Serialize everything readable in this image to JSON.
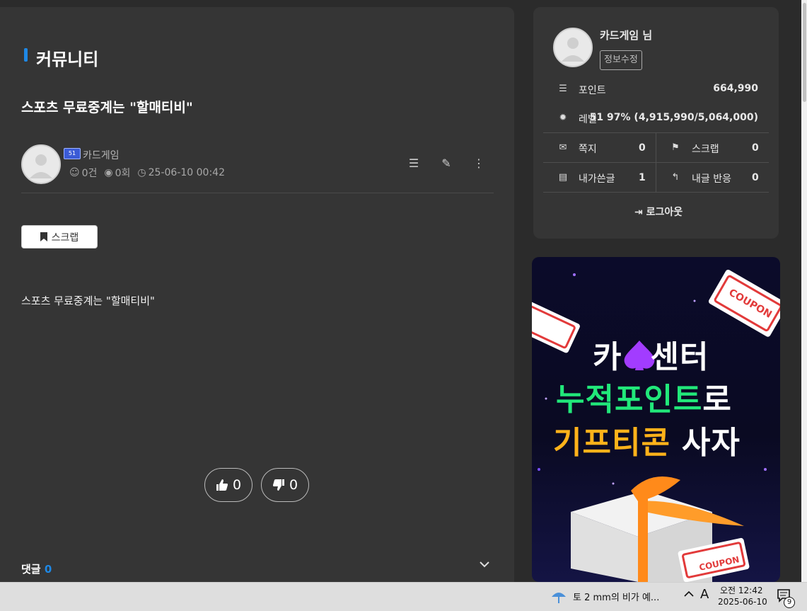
{
  "page": {
    "section_title": "커뮤니티",
    "post_title": "스포츠 무료중계는 \"할매티비\"",
    "author": {
      "level": "51",
      "name": "카드게임"
    },
    "meta": {
      "comments": "0건",
      "views": "0회",
      "datetime": "25-06-10 00:42"
    },
    "scrap_label": "스크랩",
    "body_text": "스포츠 무료중계는 \"할매티비\"",
    "likes": "0",
    "dislikes": "0",
    "comments_label": "댓글",
    "comments_count": "0"
  },
  "user_card": {
    "name": "카드게임 님",
    "edit_label": "정보수정",
    "point_label": "포인트",
    "point_value": "664,990",
    "level_label": "레벨",
    "level_value": "51 97% (4,915,990/5,064,000)",
    "memo_label": "쪽지",
    "memo_value": "0",
    "scrap_label": "스크랩",
    "scrap_value": "0",
    "posts_label": "내가쓴글",
    "posts_value": "1",
    "replies_label": "내글 반응",
    "replies_value": "0",
    "logout_label": "로그아웃"
  },
  "ad": {
    "coupon_top": "COUPON",
    "line1_a": "카",
    "line1_b": "센터",
    "line2_a": "누적포인트",
    "line2_b": "로",
    "line3_a": "기프티콘",
    "line3_b": "사자",
    "coupon_bottom": "COUPON",
    "colors": {
      "green": "#21e87a",
      "orange": "#ffb21a",
      "purple": "#a23cff"
    }
  },
  "taskbar": {
    "weather": "토 2 mm의 비가 예...",
    "ime": "A",
    "time_period": "오전 12:42",
    "date": "2025-06-10",
    "notifications": "9"
  },
  "colors": {
    "accent": "#1e88e5",
    "panel": "#353535",
    "background": "#2b2b2b"
  }
}
